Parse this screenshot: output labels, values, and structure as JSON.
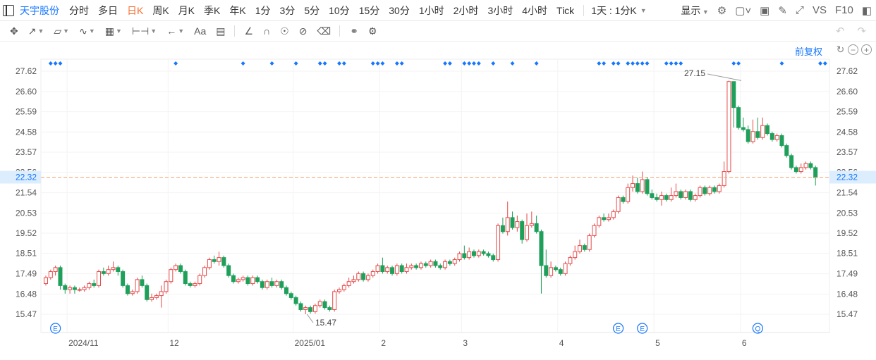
{
  "topbar": {
    "stock_name": "天宇股份",
    "periods": [
      "分时",
      "多日",
      "日K",
      "周K",
      "月K",
      "季K",
      "年K",
      "1分",
      "3分",
      "5分",
      "10分",
      "15分",
      "30分",
      "1小时",
      "2小时",
      "3小时",
      "4小时",
      "Tick"
    ],
    "active_period": "日K",
    "interval_select": "1天 : 1分K",
    "display_label": "显示",
    "vs_label": "VS",
    "f10_label": "F10"
  },
  "toolbar": {
    "text_tool_label": "Aa"
  },
  "adjust_label": "前复权",
  "colors": {
    "up": "#e84a4a",
    "down": "#1ea05a",
    "current_line": "#f5a06e",
    "marker": "#1677ff",
    "axis_text": "#555555"
  },
  "chart_data": {
    "type": "candlestick",
    "y_ticks": [
      "27.62",
      "26.60",
      "25.59",
      "24.58",
      "23.57",
      "22.56",
      "21.54",
      "20.53",
      "19.52",
      "18.51",
      "17.49",
      "16.48",
      "15.47"
    ],
    "ylim": [
      15.0,
      28.0
    ],
    "x_labels": [
      "2024/11",
      "12",
      "2025/01",
      "2",
      "3",
      "4",
      "5",
      "6"
    ],
    "x_label_index": [
      5,
      26,
      52,
      70,
      87,
      107,
      127,
      145
    ],
    "current_price": "22.32",
    "annotations": [
      {
        "label": "27.15",
        "index": 145,
        "value": 27.15
      },
      {
        "label": "15.47",
        "index": 54,
        "value": 15.47
      }
    ],
    "event_markers": [
      {
        "label": "E",
        "index": 2
      },
      {
        "label": "E",
        "index": 119
      },
      {
        "label": "E",
        "index": 124
      },
      {
        "label": "Q",
        "index": 148
      }
    ],
    "top_marker_index": [
      1,
      2,
      3,
      27,
      41,
      47,
      52,
      57,
      58,
      61,
      62,
      68,
      69,
      70,
      73,
      74,
      83,
      84,
      87,
      88,
      89,
      90,
      93,
      97,
      102,
      115,
      116,
      118,
      119,
      121,
      122,
      123,
      124,
      125,
      129,
      130,
      131,
      132,
      143,
      144,
      153,
      161,
      162
    ],
    "candles": [
      [
        17.0,
        17.3,
        17.0,
        17.4,
        16.9
      ],
      [
        17.3,
        17.6,
        17.2,
        17.7,
        17.2
      ],
      [
        17.6,
        17.8,
        17.5,
        17.9,
        17.4
      ],
      [
        17.8,
        16.9,
        16.8,
        17.9,
        16.7
      ],
      [
        16.9,
        16.7,
        16.6,
        17.0,
        16.5
      ],
      [
        16.7,
        16.8,
        16.6,
        16.9,
        16.5
      ],
      [
        16.8,
        16.7,
        16.6,
        16.9,
        16.5
      ],
      [
        16.7,
        16.7,
        16.6,
        16.8,
        16.6
      ],
      [
        16.7,
        16.8,
        16.6,
        16.9,
        16.6
      ],
      [
        16.8,
        17.0,
        16.7,
        17.1,
        16.7
      ],
      [
        17.0,
        16.9,
        16.8,
        17.2,
        16.8
      ],
      [
        16.9,
        17.6,
        16.8,
        17.7,
        16.8
      ],
      [
        17.6,
        17.5,
        17.4,
        17.8,
        17.4
      ],
      [
        17.5,
        17.7,
        17.4,
        17.9,
        17.4
      ],
      [
        17.7,
        17.8,
        17.6,
        18.1,
        17.6
      ],
      [
        17.8,
        17.6,
        17.5,
        17.9,
        17.4
      ],
      [
        17.6,
        16.9,
        16.8,
        17.7,
        16.8
      ],
      [
        16.9,
        16.5,
        16.4,
        17.0,
        16.4
      ],
      [
        16.5,
        16.6,
        16.4,
        16.7,
        16.4
      ],
      [
        16.6,
        17.2,
        16.5,
        17.3,
        16.5
      ],
      [
        17.2,
        16.9,
        16.8,
        17.4,
        16.8
      ],
      [
        16.9,
        16.2,
        16.1,
        17.0,
        16.1
      ],
      [
        16.2,
        16.3,
        16.1,
        16.5,
        16.1
      ],
      [
        16.3,
        16.4,
        16.2,
        16.5,
        16.2
      ],
      [
        16.4,
        16.6,
        16.3,
        16.9,
        15.8
      ],
      [
        16.6,
        17.1,
        16.5,
        17.2,
        16.5
      ],
      [
        17.1,
        17.7,
        17.0,
        17.8,
        17.0
      ],
      [
        17.7,
        17.9,
        17.6,
        18.0,
        17.6
      ],
      [
        17.9,
        17.6,
        17.5,
        18.0,
        17.5
      ],
      [
        17.6,
        17.0,
        16.9,
        17.7,
        16.9
      ],
      [
        17.0,
        16.9,
        16.8,
        17.1,
        16.8
      ],
      [
        16.9,
        17.0,
        16.8,
        17.1,
        16.8
      ],
      [
        17.0,
        17.4,
        16.9,
        17.5,
        16.9
      ],
      [
        17.4,
        17.8,
        17.3,
        17.9,
        17.3
      ],
      [
        17.8,
        18.2,
        17.7,
        18.3,
        17.7
      ],
      [
        18.2,
        18.1,
        18.0,
        18.4,
        18.0
      ],
      [
        18.1,
        18.3,
        18.0,
        18.6,
        17.9
      ],
      [
        18.3,
        17.9,
        17.8,
        18.4,
        17.8
      ],
      [
        17.9,
        17.4,
        17.3,
        18.0,
        17.3
      ],
      [
        17.4,
        17.1,
        17.0,
        17.5,
        17.0
      ],
      [
        17.1,
        17.2,
        17.0,
        17.3,
        17.0
      ],
      [
        17.2,
        17.3,
        17.1,
        17.4,
        17.1
      ],
      [
        17.3,
        17.0,
        16.9,
        17.4,
        16.9
      ],
      [
        17.0,
        17.3,
        16.9,
        17.4,
        16.9
      ],
      [
        17.3,
        17.1,
        17.0,
        17.4,
        17.0
      ],
      [
        17.1,
        16.8,
        16.7,
        17.2,
        16.7
      ],
      [
        16.8,
        17.1,
        16.7,
        17.2,
        16.7
      ],
      [
        17.1,
        16.9,
        16.8,
        17.3,
        16.8
      ],
      [
        16.9,
        17.1,
        16.8,
        17.2,
        16.8
      ],
      [
        17.1,
        16.8,
        16.7,
        17.2,
        16.7
      ],
      [
        16.8,
        16.5,
        16.4,
        16.9,
        16.4
      ],
      [
        16.5,
        16.3,
        16.2,
        16.6,
        16.2
      ],
      [
        16.3,
        16.0,
        15.9,
        16.4,
        15.9
      ],
      [
        16.0,
        15.7,
        15.6,
        16.1,
        15.6
      ],
      [
        15.7,
        15.8,
        15.5,
        15.9,
        15.47
      ],
      [
        15.8,
        15.6,
        15.5,
        15.9,
        15.5
      ],
      [
        15.6,
        15.9,
        15.5,
        16.0,
        15.5
      ],
      [
        15.9,
        16.1,
        15.8,
        16.2,
        15.8
      ],
      [
        16.1,
        15.8,
        15.7,
        16.2,
        15.7
      ],
      [
        15.8,
        15.7,
        15.6,
        15.9,
        15.6
      ],
      [
        15.7,
        16.6,
        15.6,
        16.7,
        15.6
      ],
      [
        16.6,
        16.7,
        16.5,
        16.8,
        16.5
      ],
      [
        16.7,
        16.9,
        16.6,
        17.0,
        16.6
      ],
      [
        16.9,
        17.1,
        16.8,
        17.3,
        16.8
      ],
      [
        17.1,
        17.2,
        17.0,
        17.4,
        17.0
      ],
      [
        17.2,
        17.5,
        17.1,
        17.6,
        17.1
      ],
      [
        17.5,
        17.2,
        17.1,
        17.6,
        17.1
      ],
      [
        17.2,
        17.4,
        17.1,
        17.5,
        17.1
      ],
      [
        17.4,
        17.6,
        17.3,
        17.7,
        17.3
      ],
      [
        17.6,
        17.9,
        17.5,
        18.0,
        17.5
      ],
      [
        17.9,
        17.6,
        17.5,
        18.3,
        17.5
      ],
      [
        17.6,
        17.8,
        17.5,
        17.9,
        17.5
      ],
      [
        17.8,
        17.5,
        17.4,
        17.9,
        17.4
      ],
      [
        17.5,
        17.9,
        17.4,
        18.0,
        17.4
      ],
      [
        17.9,
        17.6,
        17.5,
        18.0,
        17.5
      ],
      [
        17.6,
        17.8,
        17.5,
        18.0,
        17.5
      ],
      [
        17.8,
        17.9,
        17.7,
        18.0,
        17.7
      ],
      [
        17.9,
        17.8,
        17.7,
        18.0,
        17.7
      ],
      [
        17.8,
        18.0,
        17.7,
        18.1,
        17.7
      ],
      [
        18.0,
        17.9,
        17.8,
        18.1,
        17.8
      ],
      [
        17.9,
        18.1,
        17.8,
        18.2,
        17.8
      ],
      [
        18.1,
        17.9,
        17.8,
        18.2,
        17.8
      ],
      [
        17.9,
        17.8,
        17.7,
        18.0,
        17.7
      ],
      [
        17.8,
        18.1,
        17.7,
        18.2,
        17.7
      ],
      [
        18.1,
        18.0,
        17.9,
        18.2,
        17.9
      ],
      [
        18.0,
        18.2,
        17.9,
        18.3,
        17.9
      ],
      [
        18.2,
        18.5,
        18.1,
        18.6,
        18.1
      ],
      [
        18.5,
        18.3,
        18.2,
        18.9,
        18.2
      ],
      [
        18.3,
        18.6,
        18.2,
        18.8,
        18.2
      ],
      [
        18.6,
        18.4,
        18.3,
        18.7,
        18.3
      ],
      [
        18.4,
        18.6,
        18.3,
        18.7,
        18.3
      ],
      [
        18.6,
        18.5,
        18.4,
        18.7,
        18.4
      ],
      [
        18.5,
        18.4,
        18.3,
        18.6,
        18.3
      ],
      [
        18.4,
        18.2,
        18.1,
        18.5,
        18.1
      ],
      [
        18.2,
        19.9,
        18.1,
        20.0,
        18.1
      ],
      [
        19.9,
        19.6,
        19.5,
        20.3,
        19.5
      ],
      [
        19.6,
        20.3,
        19.5,
        21.1,
        19.4
      ],
      [
        20.3,
        19.8,
        19.7,
        20.6,
        19.7
      ],
      [
        19.8,
        20.1,
        19.7,
        20.4,
        19.6
      ],
      [
        20.1,
        19.2,
        19.1,
        20.2,
        19.0
      ],
      [
        19.2,
        19.9,
        19.1,
        20.5,
        19.1
      ],
      [
        19.9,
        20.0,
        19.8,
        20.6,
        19.8
      ],
      [
        20.0,
        19.6,
        19.5,
        20.4,
        19.5
      ],
      [
        19.6,
        17.9,
        17.8,
        19.7,
        16.5
      ],
      [
        17.9,
        17.4,
        17.3,
        18.7,
        17.3
      ],
      [
        17.4,
        17.8,
        17.3,
        18.1,
        17.3
      ],
      [
        17.8,
        17.7,
        17.6,
        17.9,
        17.6
      ],
      [
        17.7,
        17.5,
        17.4,
        17.8,
        17.4
      ],
      [
        17.5,
        18.0,
        17.4,
        18.1,
        17.4
      ],
      [
        18.0,
        18.3,
        17.9,
        18.4,
        17.9
      ],
      [
        18.3,
        18.6,
        18.2,
        18.9,
        18.2
      ],
      [
        18.6,
        18.9,
        18.5,
        19.2,
        18.5
      ],
      [
        18.9,
        18.7,
        18.6,
        19.0,
        18.6
      ],
      [
        18.7,
        19.4,
        18.6,
        19.5,
        18.6
      ],
      [
        19.4,
        19.9,
        19.3,
        20.0,
        19.3
      ],
      [
        19.9,
        20.3,
        19.8,
        20.4,
        19.8
      ],
      [
        20.3,
        20.2,
        20.1,
        20.5,
        20.1
      ],
      [
        20.2,
        20.3,
        20.1,
        20.5,
        20.1
      ],
      [
        20.3,
        20.6,
        20.2,
        20.7,
        20.2
      ],
      [
        20.6,
        21.3,
        20.5,
        21.4,
        20.5
      ],
      [
        21.3,
        21.1,
        21.0,
        21.4,
        21.0
      ],
      [
        21.1,
        21.8,
        21.0,
        22.0,
        21.0
      ],
      [
        21.8,
        22.0,
        21.7,
        22.4,
        21.6
      ],
      [
        22.0,
        21.6,
        21.5,
        22.3,
        21.5
      ],
      [
        21.6,
        22.2,
        21.5,
        22.6,
        21.5
      ],
      [
        22.2,
        21.5,
        21.4,
        22.3,
        21.4
      ],
      [
        21.5,
        21.3,
        21.2,
        21.7,
        21.2
      ],
      [
        21.3,
        21.2,
        21.1,
        21.5,
        21.1
      ],
      [
        21.2,
        21.4,
        21.1,
        21.6,
        20.9
      ],
      [
        21.4,
        21.2,
        21.1,
        21.5,
        21.1
      ],
      [
        21.2,
        21.4,
        21.1,
        21.8,
        21.1
      ],
      [
        21.4,
        21.6,
        21.3,
        22.0,
        21.3
      ],
      [
        21.6,
        21.3,
        21.2,
        21.7,
        21.2
      ],
      [
        21.3,
        21.6,
        21.2,
        21.7,
        21.2
      ],
      [
        21.6,
        21.2,
        21.1,
        21.7,
        21.1
      ],
      [
        21.2,
        21.4,
        21.1,
        21.5,
        21.1
      ],
      [
        21.4,
        21.8,
        21.3,
        21.9,
        21.3
      ],
      [
        21.8,
        21.5,
        21.4,
        21.9,
        21.4
      ],
      [
        21.5,
        21.8,
        21.4,
        21.9,
        21.4
      ],
      [
        21.8,
        21.6,
        21.5,
        21.9,
        21.5
      ],
      [
        21.6,
        21.9,
        21.5,
        22.0,
        21.5
      ],
      [
        21.9,
        22.6,
        21.8,
        23.1,
        21.8
      ],
      [
        22.6,
        27.1,
        22.5,
        27.15,
        22.5
      ],
      [
        27.1,
        25.8,
        25.6,
        27.0,
        24.8
      ],
      [
        25.8,
        24.8,
        24.7,
        25.9,
        24.7
      ],
      [
        24.8,
        24.7,
        24.6,
        25.3,
        24.6
      ],
      [
        24.7,
        24.1,
        24.0,
        24.9,
        24.0
      ],
      [
        24.1,
        24.6,
        24.0,
        25.2,
        24.0
      ],
      [
        24.6,
        24.3,
        24.2,
        25.3,
        24.2
      ],
      [
        24.3,
        24.9,
        24.2,
        25.3,
        24.2
      ],
      [
        24.9,
        24.5,
        24.4,
        25.0,
        24.4
      ],
      [
        24.5,
        24.2,
        24.1,
        24.6,
        24.1
      ],
      [
        24.2,
        24.4,
        24.1,
        24.5,
        24.1
      ],
      [
        24.4,
        23.9,
        23.8,
        24.5,
        23.8
      ],
      [
        23.9,
        23.4,
        23.3,
        24.0,
        23.3
      ],
      [
        23.4,
        22.8,
        22.7,
        23.5,
        22.7
      ],
      [
        22.8,
        22.6,
        22.5,
        22.9,
        22.5
      ],
      [
        22.6,
        22.8,
        22.5,
        23.0,
        22.5
      ],
      [
        22.8,
        23.0,
        22.7,
        23.1,
        22.7
      ],
      [
        23.0,
        22.8,
        22.7,
        23.1,
        22.7
      ],
      [
        22.8,
        22.3,
        21.9,
        22.9,
        21.9
      ]
    ]
  }
}
